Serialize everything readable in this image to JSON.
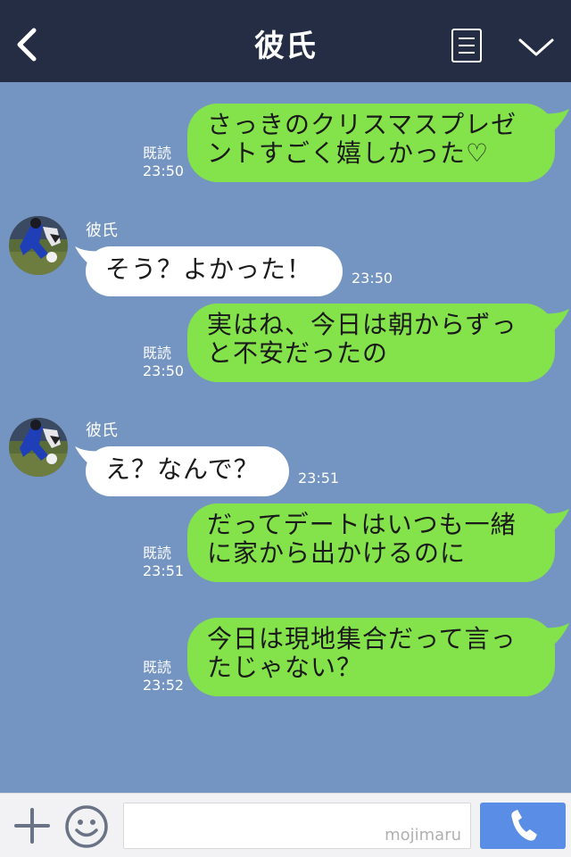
{
  "header": {
    "title": "彼氏",
    "back_icon": "back-chevron-icon",
    "menu_icon": "menu-icon",
    "more_icon": "chevron-down-icon",
    "bg_color": "#242d43"
  },
  "messages": [
    {
      "side": "out",
      "text1": "さっきのクリスマスプレゼ",
      "text2": "ントすごく嬉しかった♡",
      "read": "既読",
      "time": "23:50"
    },
    {
      "side": "in",
      "sender": "彼氏",
      "text": "そう？よかった！",
      "time": "23:50"
    },
    {
      "side": "out",
      "text1": "実はね、今日は朝からずっ",
      "text2": "と不安だったの",
      "read": "既読",
      "time": "23:50"
    },
    {
      "side": "in",
      "sender": "彼氏",
      "text": "え？なんで？",
      "time": "23:51"
    },
    {
      "side": "out",
      "text1": "だってデートはいつも一緒",
      "text2": "に家から出かけるのに",
      "read": "既読",
      "time": "23:51"
    },
    {
      "side": "out",
      "text1": "今日は現地集合だって言っ",
      "text2": "たじゃない？",
      "read": "既読",
      "time": "23:52"
    }
  ],
  "input_bar": {
    "watermark": "mojimaru",
    "plus_icon": "plus-icon",
    "emoji_icon": "smiley-icon",
    "call_icon": "phone-icon"
  },
  "colors": {
    "chat_bg": "#7494c1",
    "out_bubble": "#84e34b",
    "in_bubble": "#ffffff",
    "call_button": "#5a8ee6"
  }
}
